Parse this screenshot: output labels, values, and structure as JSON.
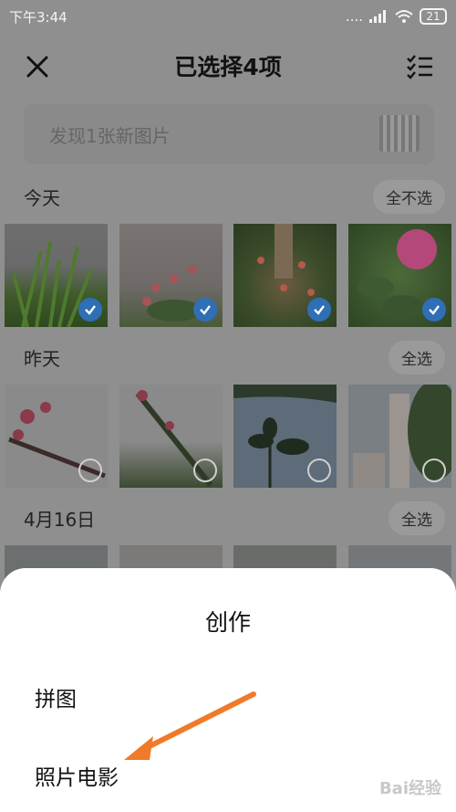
{
  "status_bar": {
    "time": "下午3:44",
    "signal": "....",
    "battery": "21"
  },
  "header": {
    "title": "已选择4项"
  },
  "discover": {
    "text": "发现1张新图片"
  },
  "sections": [
    {
      "label": "今天",
      "action": "全不选"
    },
    {
      "label": "昨天",
      "action": "全选"
    },
    {
      "label": "4月16日",
      "action": "全选"
    }
  ],
  "sheet": {
    "title": "创作",
    "items": [
      "拼图",
      "照片电影"
    ]
  },
  "watermark": {
    "text": "Bai经验"
  },
  "colors": {
    "accent": "#2e6fb5",
    "arrow": "#f07a2a",
    "overlay": "#8f8f8f"
  }
}
